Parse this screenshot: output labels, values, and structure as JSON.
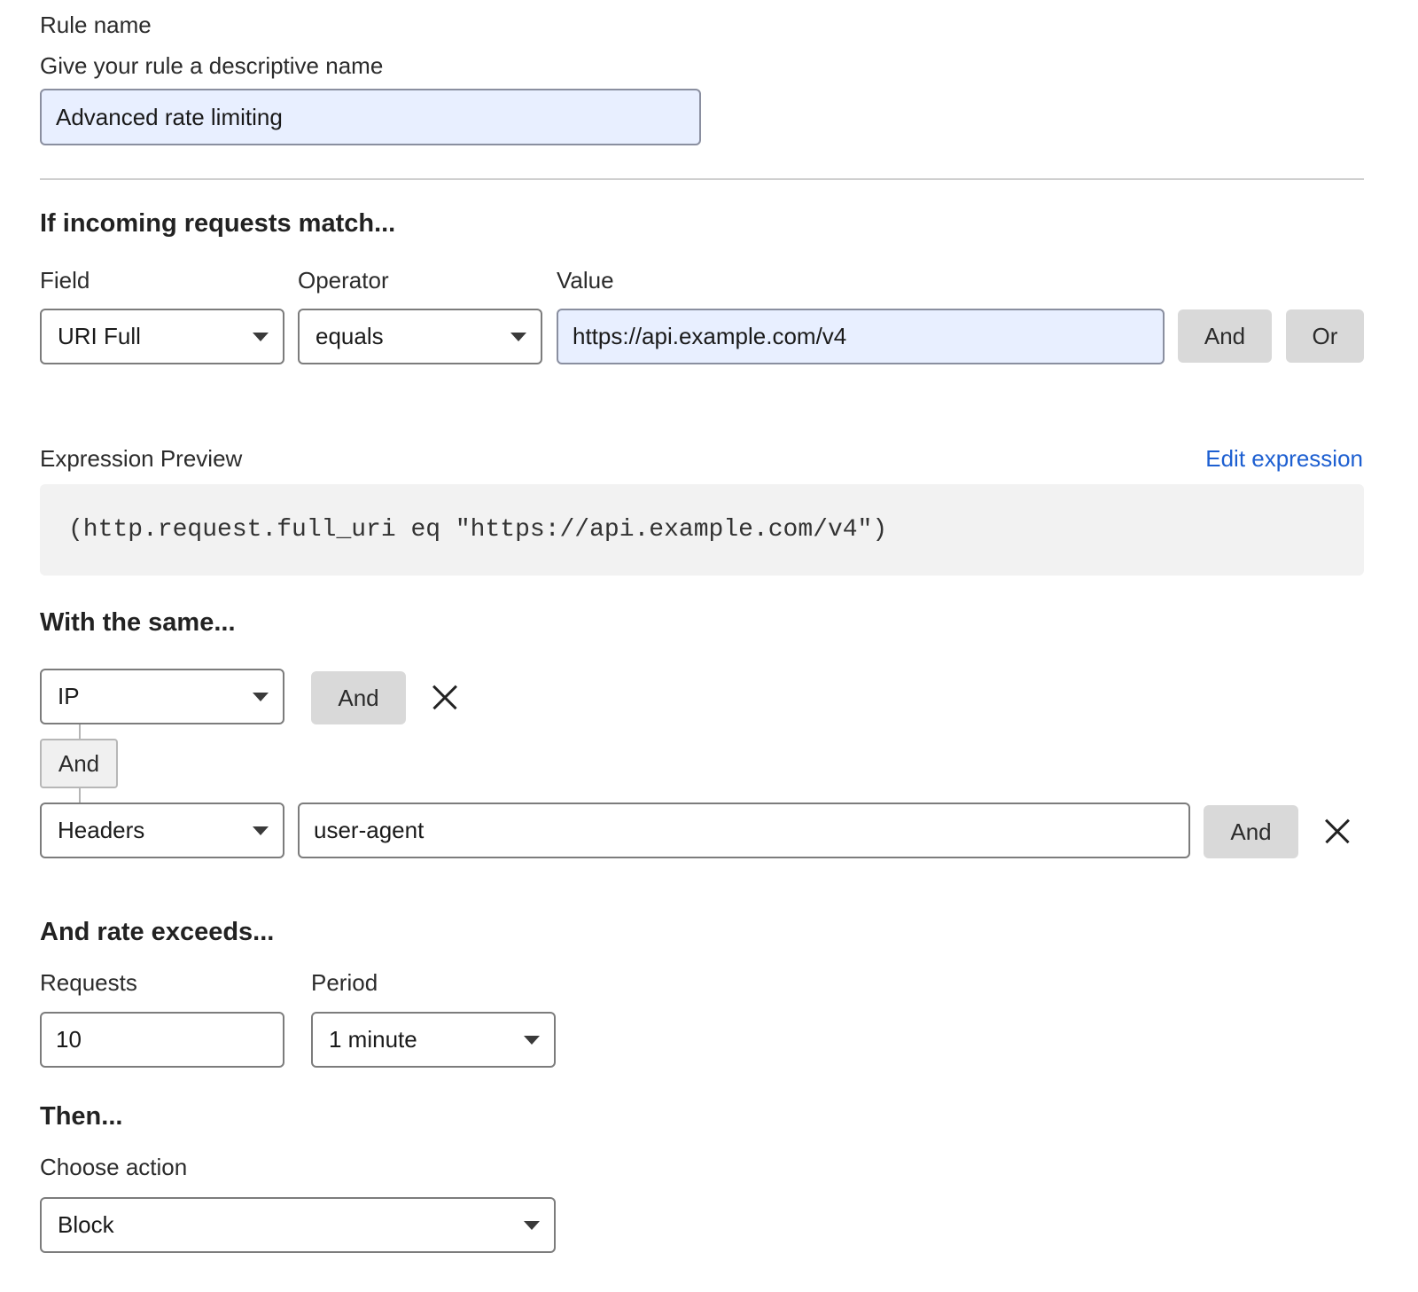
{
  "rule_name": {
    "label": "Rule name",
    "hint": "Give your rule a descriptive name",
    "value": "Advanced rate limiting"
  },
  "match": {
    "heading": "If incoming requests match...",
    "field_label": "Field",
    "operator_label": "Operator",
    "value_label": "Value",
    "field_value": "URI Full",
    "operator_value": "equals",
    "value_value": "https://api.example.com/v4",
    "and_label": "And",
    "or_label": "Or"
  },
  "expression": {
    "label": "Expression Preview",
    "edit_link": "Edit expression",
    "code": "(http.request.full_uri eq \"https://api.example.com/v4\")"
  },
  "same": {
    "heading": "With the same...",
    "row1_select": "IP",
    "row1_and": "And",
    "join_label": "And",
    "row2_select": "Headers",
    "row2_value": "user-agent",
    "row2_and": "And"
  },
  "rate": {
    "heading": "And rate exceeds...",
    "requests_label": "Requests",
    "period_label": "Period",
    "requests_value": "10",
    "period_value": "1 minute"
  },
  "then": {
    "heading": "Then...",
    "action_label": "Choose action",
    "action_value": "Block"
  },
  "icons": {
    "dropdown": "chevron-down-icon",
    "remove": "close-icon"
  },
  "colors": {
    "filled_input_bg": "#e8efff",
    "button_bg": "#d9d9d9",
    "link": "#1d5fd1",
    "preview_bg": "#f2f2f2"
  }
}
